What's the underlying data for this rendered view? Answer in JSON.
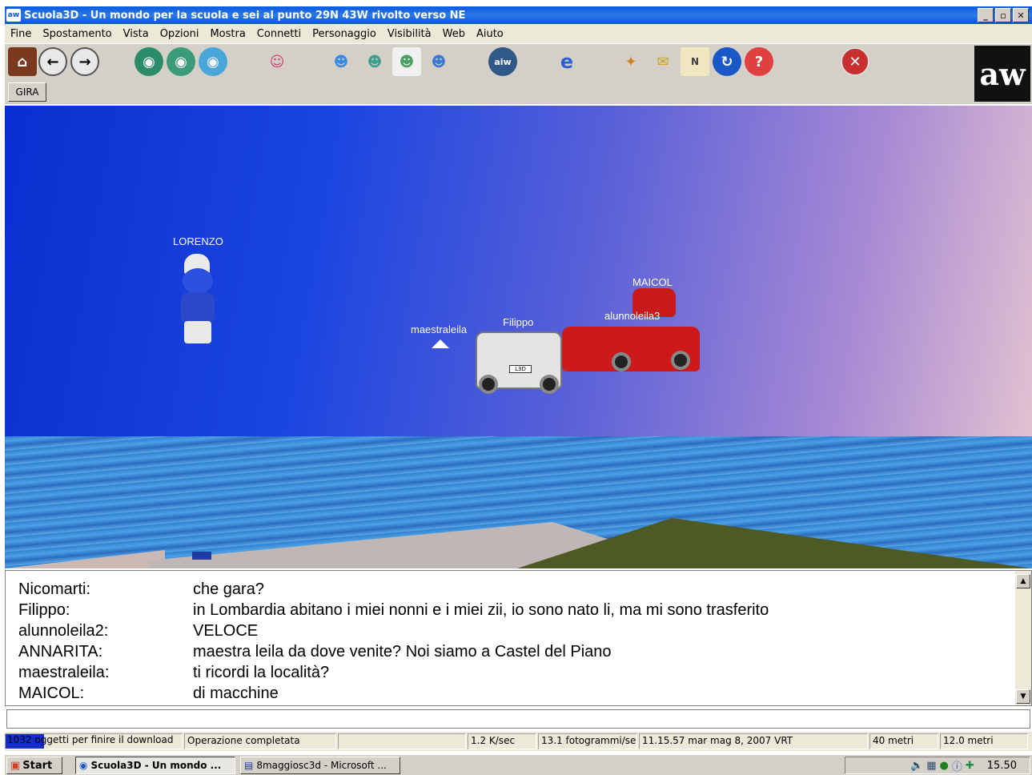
{
  "window": {
    "title": "Scuola3D - Un mondo per la scuola e sei al punto 29N 43W rivolto verso NE",
    "app_icon": "aw-app-icon",
    "controls": {
      "minimize": "_",
      "maximize": "▫",
      "close": "✕"
    }
  },
  "menu": [
    "Fine",
    "Spostamento",
    "Vista",
    "Opzioni",
    "Mostra",
    "Connetti",
    "Personaggio",
    "Visibilità",
    "Web",
    "Aiuto"
  ],
  "toolbar": {
    "gira_label": "GIRA",
    "logo_text": "aw",
    "icons": [
      "home-icon",
      "back-icon",
      "forward-icon",
      "view-first-person-icon",
      "view-third-person-icon",
      "view-front-icon",
      "telegram-icon",
      "user-icon",
      "eye-user-icon",
      "user-selected-icon",
      "users-icon",
      "aiw-icon",
      "browser-icon",
      "tool-rocket-icon",
      "tool-envelope-icon",
      "compass-icon",
      "refresh-icon",
      "help-icon",
      "exit-icon"
    ]
  },
  "scene": {
    "avatars": [
      "LORENZO",
      "maestraleila",
      "Filippo",
      "MAICOL",
      "alunnoleila3"
    ]
  },
  "chat": {
    "messages": [
      {
        "name": "Nicomarti:",
        "text": "che gara?"
      },
      {
        "name": "Filippo:",
        "text": "in Lombardia abitano i miei nonni e i miei zii, io sono nato li, ma mi sono trasferito"
      },
      {
        "name": "alunnoleila2:",
        "text": "VELOCE"
      },
      {
        "name": "ANNARITA:",
        "text": "maestra leila da dove venite? Noi siamo a Castel del Piano"
      },
      {
        "name": "maestraleila:",
        "text": "ti ricordi la località?"
      },
      {
        "name": "MAICOL:",
        "text": "di macchine"
      }
    ]
  },
  "status": {
    "download": "1032 oggetti per finire il download",
    "download_progress": 0.22,
    "operation": "Operazione completata",
    "speed": "1.2 K/sec",
    "fps": "13.1 fotogrammi/sec",
    "datetime": "11.15.57 mar mag 8, 2007 VRT",
    "distance": "40 metri",
    "visibility": "12.0 metri"
  },
  "taskbar": {
    "start": "Start",
    "tasks": [
      "Scuola3D - Un mondo ...",
      "8maggiosc3d - Microsoft ..."
    ],
    "clock": "15.50"
  },
  "colors": {
    "titlebar": "#0a5be0",
    "sky_left": "#0a2fd0",
    "sky_right": "#e8c8d0",
    "sea": "#2f7fd0",
    "car_red": "#cc1a1a",
    "car_white": "#e6e6e6"
  }
}
